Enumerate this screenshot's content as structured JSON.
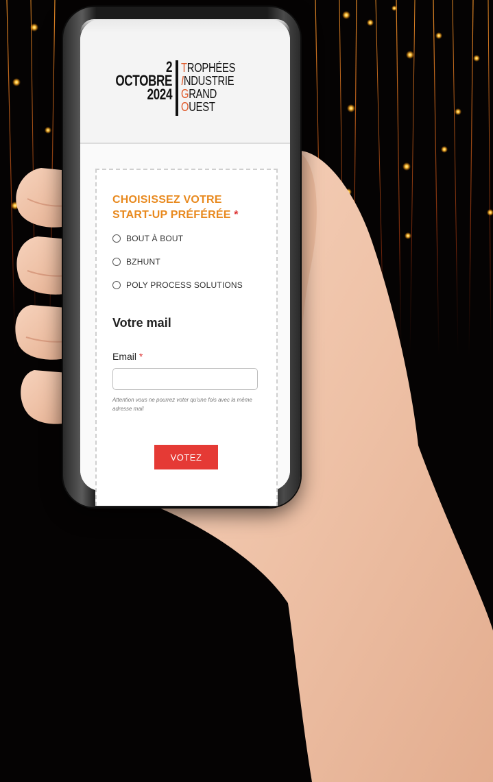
{
  "event_logo": {
    "day": "2",
    "month": "OCTOBRE",
    "year": "2024",
    "words": [
      {
        "first": "T",
        "rest": "ROPHÉES"
      },
      {
        "first": "I",
        "rest": "NDUSTRIE"
      },
      {
        "first": "G",
        "rest": "RAND"
      },
      {
        "first": "O",
        "rest": "UEST"
      }
    ]
  },
  "form": {
    "question_line1": "CHOISISSEZ VOTRE",
    "question_line2": "START-UP PRÉFÉRÉE",
    "required_mark": "*",
    "options": [
      "BOUT À BOUT",
      "BZHUNT",
      "POLY PROCESS SOLUTIONS"
    ],
    "section_title": "Votre mail",
    "email_label": "Email",
    "email_value": "",
    "hint": "Attention vous ne pourrez voter qu'une fois avec la même adresse mail",
    "submit_label": "VOTEZ"
  },
  "colors": {
    "accent_orange": "#e8891e",
    "button_red": "#e53a35",
    "logo_orange": "#e05a2a",
    "background": "#050303"
  }
}
